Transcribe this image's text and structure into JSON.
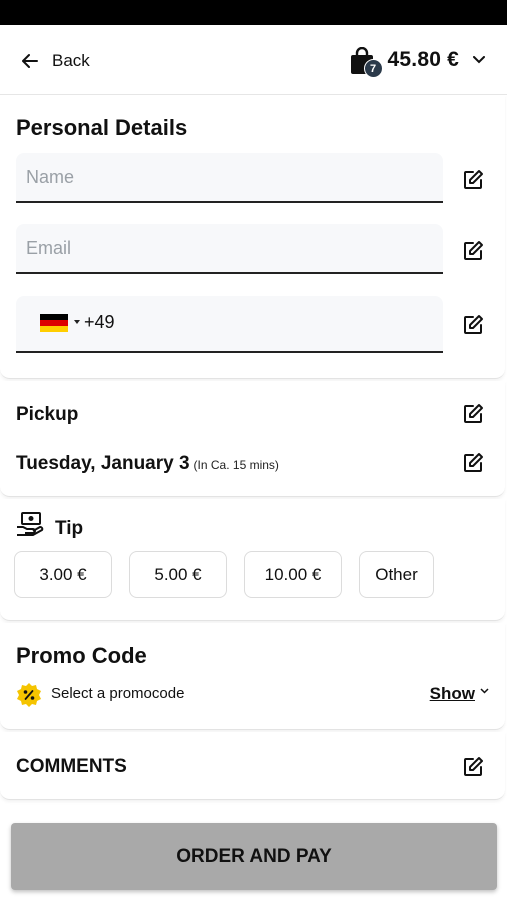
{
  "header": {
    "back_label": "Back",
    "cart_count": "7",
    "cart_total": "45.80 €"
  },
  "personal": {
    "title": "Personal Details",
    "name_placeholder": "Name",
    "email_placeholder": "Email",
    "phone_code": "+49"
  },
  "pickup": {
    "label": "Pickup",
    "date": "Tuesday, January 3",
    "note": "(In Ca. 15 mins)"
  },
  "tip": {
    "label": "Tip",
    "options": [
      "3.00 €",
      "5.00 €",
      "10.00 €",
      "Other"
    ]
  },
  "promo": {
    "title": "Promo Code",
    "select_label": "Select a promocode",
    "show_label": "Show"
  },
  "comments": {
    "label": "COMMENTS"
  },
  "order_button": "ORDER AND PAY",
  "colors": {
    "order_button_bg": "#a9a9a9",
    "promo_icon": "#f5c400",
    "field_bg": "#f7f8fa"
  }
}
